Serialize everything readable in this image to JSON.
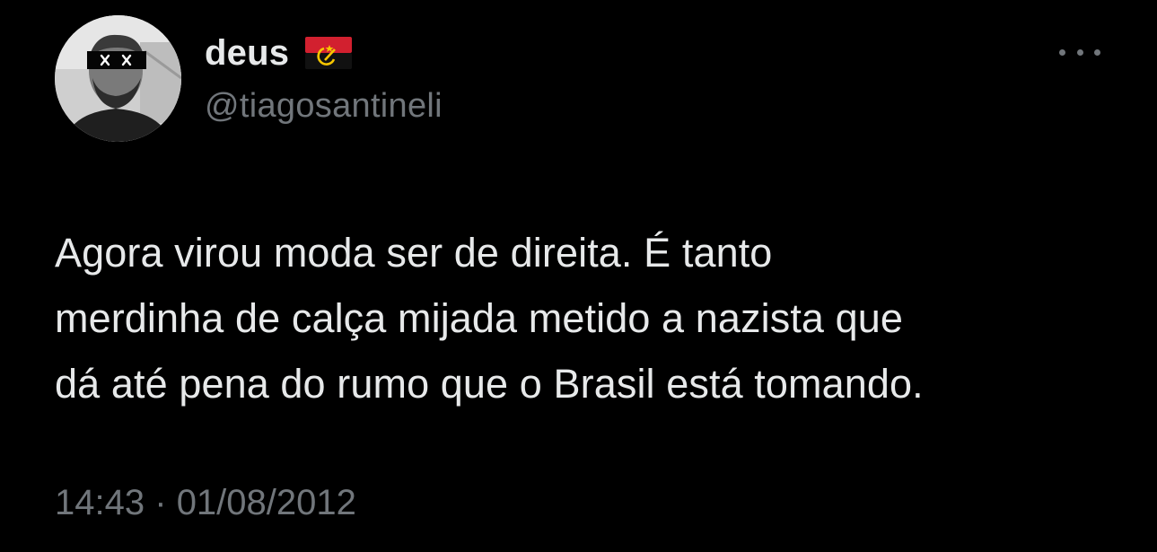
{
  "author": {
    "display_name": "deus",
    "flag_emoji": "angola-flag",
    "handle": "@tiagosantineli"
  },
  "actions": {
    "more_icon": "more-horizontal-icon"
  },
  "tweet": {
    "text_lines": [
      "Agora virou moda ser de direita. É tanto",
      "merdinha de calça mijada metido a nazista que",
      "dá até pena do rumo que o Brasil está tomando."
    ],
    "time": "14:43",
    "separator": "·",
    "date": "01/08/2012"
  },
  "colors": {
    "background": "#000000",
    "primary_text": "#e7e9ea",
    "secondary_text": "#71767b",
    "flag_red": "#d2202f",
    "flag_black": "#111111",
    "flag_yellow": "#f7c600"
  }
}
